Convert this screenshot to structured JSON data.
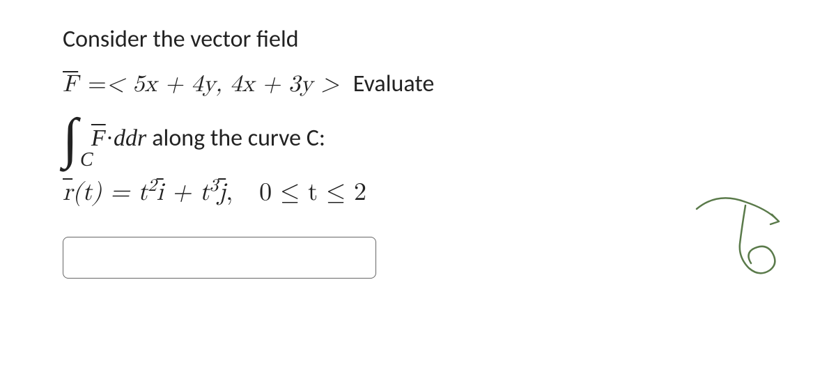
{
  "problem": {
    "intro": "Consider the vector field",
    "vectorFieldLHS": "F",
    "equals": " = ",
    "fieldExpr": " < 5x + 4y, 4x + 3y > ",
    "evaluateLabel": "Evaluate",
    "integralF": "F",
    "dot": " · ",
    "dr": "dr",
    "alongText": " along the curve C:",
    "rLabel": "r",
    "rArg": "(t) = t",
    "exp1": "2",
    "iVec": "i",
    "plus": " + t",
    "exp2": "3",
    "jVec": "j",
    "comma": ", ",
    "bounds": "0 ≤ t ≤ 2",
    "integralSubscript": "C"
  },
  "answer": {
    "value": "",
    "placeholder": ""
  }
}
